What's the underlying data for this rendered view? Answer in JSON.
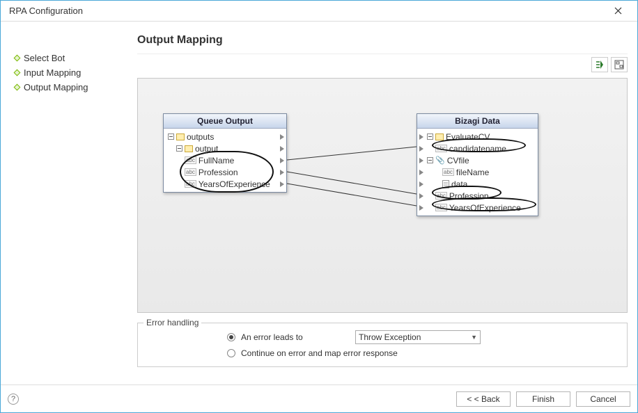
{
  "window": {
    "title": "RPA Configuration"
  },
  "sidebar": {
    "items": [
      {
        "label": "Select Bot"
      },
      {
        "label": "Input Mapping"
      },
      {
        "label": "Output Mapping"
      }
    ]
  },
  "heading": "Output Mapping",
  "panels": {
    "left": {
      "title": "Queue Output",
      "rows": [
        {
          "label": "outputs",
          "icon": "folder"
        },
        {
          "label": "output",
          "icon": "folder"
        },
        {
          "label": "FullName",
          "icon": "abc"
        },
        {
          "label": "Profession",
          "icon": "abc"
        },
        {
          "label": "YearsOfExperience",
          "icon": "abc"
        }
      ]
    },
    "right": {
      "title": "Bizagi Data",
      "rows": [
        {
          "label": "EvaluateCV",
          "icon": "folder"
        },
        {
          "label": "candidatename",
          "icon": "abc"
        },
        {
          "label": "CVfile",
          "icon": "clip"
        },
        {
          "label": "fileName",
          "icon": "abc"
        },
        {
          "label": "data",
          "icon": "file"
        },
        {
          "label": "Profession",
          "icon": "abc"
        },
        {
          "label": "YearsOfExperience",
          "icon": "abc"
        }
      ]
    }
  },
  "errorHandling": {
    "legend": "Error handling",
    "option1": "An error leads to",
    "option2": "Continue on error and map error response",
    "selectValue": "Throw Exception"
  },
  "buttons": {
    "back": "< < Back",
    "finish": "Finish",
    "cancel": "Cancel"
  }
}
